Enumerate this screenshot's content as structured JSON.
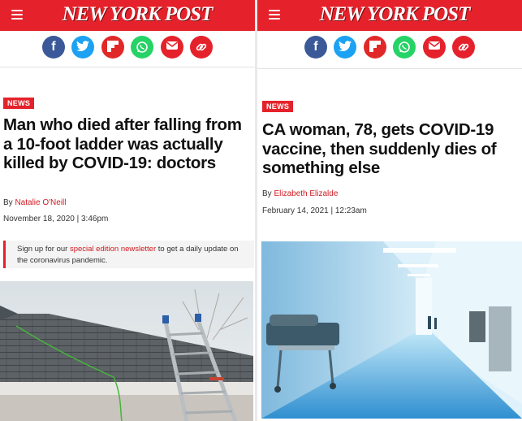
{
  "left": {
    "logo": "NEW YORK POST",
    "badge": "NEWS",
    "headline": "Man who died after falling from a 10-foot ladder was actually killed by COVID-19: doctors",
    "byline_prefix": "By ",
    "author": "Natalie O'Neill",
    "date": "November 18, 2020 | 3:46pm",
    "signup": {
      "before": "Sign up for our ",
      "link": "special edition newsletter",
      "after": " to get a daily update on the coronavirus pandemic."
    }
  },
  "right": {
    "logo": "NEW YORK POST",
    "badge": "NEWS",
    "headline": "CA woman, 78, gets COVID-19 vaccine, then suddenly dies of something else",
    "byline_prefix": "By ",
    "author": "Elizabeth Elizalde",
    "date": "February 14, 2021 | 12:23am"
  },
  "share_icons": [
    {
      "name": "facebook",
      "color": "#3b5998"
    },
    {
      "name": "twitter",
      "color": "#1da1f2"
    },
    {
      "name": "flipboard",
      "color": "#e12828"
    },
    {
      "name": "whatsapp",
      "color": "#25d366"
    },
    {
      "name": "email",
      "color": "#e5222b"
    },
    {
      "name": "link",
      "color": "#e5222b"
    }
  ],
  "colors": {
    "brand_red": "#e5222b",
    "author_red": "#cf1b22"
  }
}
